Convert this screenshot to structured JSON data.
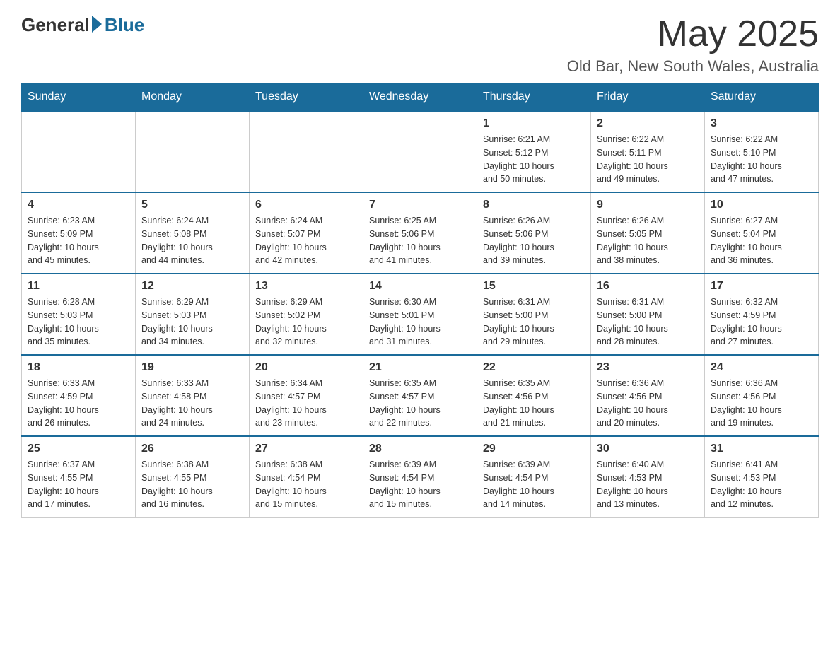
{
  "header": {
    "logo_general": "General",
    "logo_blue": "Blue",
    "month_title": "May 2025",
    "location": "Old Bar, New South Wales, Australia"
  },
  "days_of_week": [
    "Sunday",
    "Monday",
    "Tuesday",
    "Wednesday",
    "Thursday",
    "Friday",
    "Saturday"
  ],
  "weeks": [
    [
      {
        "day": "",
        "info": ""
      },
      {
        "day": "",
        "info": ""
      },
      {
        "day": "",
        "info": ""
      },
      {
        "day": "",
        "info": ""
      },
      {
        "day": "1",
        "info": "Sunrise: 6:21 AM\nSunset: 5:12 PM\nDaylight: 10 hours\nand 50 minutes."
      },
      {
        "day": "2",
        "info": "Sunrise: 6:22 AM\nSunset: 5:11 PM\nDaylight: 10 hours\nand 49 minutes."
      },
      {
        "day": "3",
        "info": "Sunrise: 6:22 AM\nSunset: 5:10 PM\nDaylight: 10 hours\nand 47 minutes."
      }
    ],
    [
      {
        "day": "4",
        "info": "Sunrise: 6:23 AM\nSunset: 5:09 PM\nDaylight: 10 hours\nand 45 minutes."
      },
      {
        "day": "5",
        "info": "Sunrise: 6:24 AM\nSunset: 5:08 PM\nDaylight: 10 hours\nand 44 minutes."
      },
      {
        "day": "6",
        "info": "Sunrise: 6:24 AM\nSunset: 5:07 PM\nDaylight: 10 hours\nand 42 minutes."
      },
      {
        "day": "7",
        "info": "Sunrise: 6:25 AM\nSunset: 5:06 PM\nDaylight: 10 hours\nand 41 minutes."
      },
      {
        "day": "8",
        "info": "Sunrise: 6:26 AM\nSunset: 5:06 PM\nDaylight: 10 hours\nand 39 minutes."
      },
      {
        "day": "9",
        "info": "Sunrise: 6:26 AM\nSunset: 5:05 PM\nDaylight: 10 hours\nand 38 minutes."
      },
      {
        "day": "10",
        "info": "Sunrise: 6:27 AM\nSunset: 5:04 PM\nDaylight: 10 hours\nand 36 minutes."
      }
    ],
    [
      {
        "day": "11",
        "info": "Sunrise: 6:28 AM\nSunset: 5:03 PM\nDaylight: 10 hours\nand 35 minutes."
      },
      {
        "day": "12",
        "info": "Sunrise: 6:29 AM\nSunset: 5:03 PM\nDaylight: 10 hours\nand 34 minutes."
      },
      {
        "day": "13",
        "info": "Sunrise: 6:29 AM\nSunset: 5:02 PM\nDaylight: 10 hours\nand 32 minutes."
      },
      {
        "day": "14",
        "info": "Sunrise: 6:30 AM\nSunset: 5:01 PM\nDaylight: 10 hours\nand 31 minutes."
      },
      {
        "day": "15",
        "info": "Sunrise: 6:31 AM\nSunset: 5:00 PM\nDaylight: 10 hours\nand 29 minutes."
      },
      {
        "day": "16",
        "info": "Sunrise: 6:31 AM\nSunset: 5:00 PM\nDaylight: 10 hours\nand 28 minutes."
      },
      {
        "day": "17",
        "info": "Sunrise: 6:32 AM\nSunset: 4:59 PM\nDaylight: 10 hours\nand 27 minutes."
      }
    ],
    [
      {
        "day": "18",
        "info": "Sunrise: 6:33 AM\nSunset: 4:59 PM\nDaylight: 10 hours\nand 26 minutes."
      },
      {
        "day": "19",
        "info": "Sunrise: 6:33 AM\nSunset: 4:58 PM\nDaylight: 10 hours\nand 24 minutes."
      },
      {
        "day": "20",
        "info": "Sunrise: 6:34 AM\nSunset: 4:57 PM\nDaylight: 10 hours\nand 23 minutes."
      },
      {
        "day": "21",
        "info": "Sunrise: 6:35 AM\nSunset: 4:57 PM\nDaylight: 10 hours\nand 22 minutes."
      },
      {
        "day": "22",
        "info": "Sunrise: 6:35 AM\nSunset: 4:56 PM\nDaylight: 10 hours\nand 21 minutes."
      },
      {
        "day": "23",
        "info": "Sunrise: 6:36 AM\nSunset: 4:56 PM\nDaylight: 10 hours\nand 20 minutes."
      },
      {
        "day": "24",
        "info": "Sunrise: 6:36 AM\nSunset: 4:56 PM\nDaylight: 10 hours\nand 19 minutes."
      }
    ],
    [
      {
        "day": "25",
        "info": "Sunrise: 6:37 AM\nSunset: 4:55 PM\nDaylight: 10 hours\nand 17 minutes."
      },
      {
        "day": "26",
        "info": "Sunrise: 6:38 AM\nSunset: 4:55 PM\nDaylight: 10 hours\nand 16 minutes."
      },
      {
        "day": "27",
        "info": "Sunrise: 6:38 AM\nSunset: 4:54 PM\nDaylight: 10 hours\nand 15 minutes."
      },
      {
        "day": "28",
        "info": "Sunrise: 6:39 AM\nSunset: 4:54 PM\nDaylight: 10 hours\nand 15 minutes."
      },
      {
        "day": "29",
        "info": "Sunrise: 6:39 AM\nSunset: 4:54 PM\nDaylight: 10 hours\nand 14 minutes."
      },
      {
        "day": "30",
        "info": "Sunrise: 6:40 AM\nSunset: 4:53 PM\nDaylight: 10 hours\nand 13 minutes."
      },
      {
        "day": "31",
        "info": "Sunrise: 6:41 AM\nSunset: 4:53 PM\nDaylight: 10 hours\nand 12 minutes."
      }
    ]
  ]
}
